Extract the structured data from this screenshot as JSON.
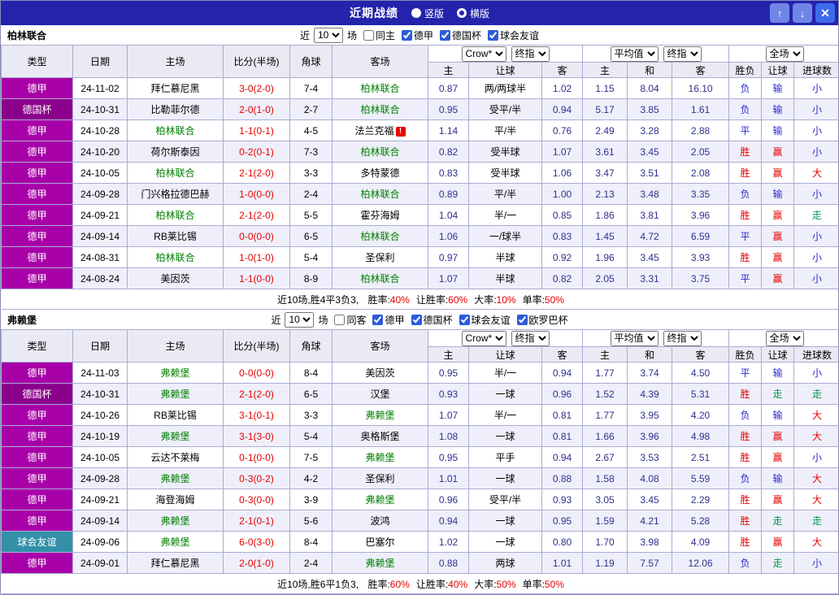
{
  "titlebar": {
    "title": "近期战绩",
    "vertical_label": "竖版",
    "horizontal_label": "横版",
    "selected_layout": "横版",
    "up_label": "↑",
    "down_label": "↓",
    "close_label": "✕"
  },
  "filter_labels": {
    "recent": "近",
    "games": "场"
  },
  "headers": {
    "type": "类型",
    "date": "日期",
    "home": "主场",
    "score": "比分(半场)",
    "corner": "角球",
    "away": "客场",
    "asian_dropdowns": [
      "Crow*",
      "终指"
    ],
    "euro_dropdowns": [
      "平均值",
      "终指"
    ],
    "full_dropdown": "全场",
    "asian_cols": [
      "主",
      "让球",
      "客"
    ],
    "euro_cols": [
      "主",
      "和",
      "客"
    ],
    "result_cols": [
      "胜负",
      "让球",
      "进球数"
    ]
  },
  "colors": {
    "accent": "#2323AC",
    "self_team": "#008000",
    "score": "#E60000",
    "odds": "#30308C",
    "league": {
      "德甲": "#A800A8",
      "德国杯": "#8B008B",
      "球会友谊": "#3390A8"
    },
    "result": {
      "胜": "#E60000",
      "赢": "#E60000",
      "大": "#E60000",
      "平": "#2929CC",
      "负": "#2929CC",
      "输": "#2929CC",
      "小": "#2929CC",
      "走": "#00994D"
    }
  },
  "sections": [
    {
      "team": "柏林联合",
      "filters": {
        "count": "10",
        "venue": "同主",
        "venue_checked": false,
        "leagues": [
          "德甲",
          "德国杯",
          "球会友谊"
        ]
      },
      "rows": [
        {
          "league": "德甲",
          "date": "24-11-02",
          "home": "拜仁慕尼黑",
          "home_self": false,
          "score": "3-0(2-0)",
          "corner": "7-4",
          "away": "柏林联合",
          "away_self": true,
          "away_alert": false,
          "asian": [
            "0.87",
            "两/两球半",
            "1.02"
          ],
          "euro": [
            "1.15",
            "8.04",
            "16.10"
          ],
          "results": [
            "负",
            "输",
            "小"
          ]
        },
        {
          "league": "德国杯",
          "date": "24-10-31",
          "home": "比勒菲尔德",
          "home_self": false,
          "score": "2-0(1-0)",
          "corner": "2-7",
          "away": "柏林联合",
          "away_self": true,
          "away_alert": false,
          "asian": [
            "0.95",
            "受平/半",
            "0.94"
          ],
          "euro": [
            "5.17",
            "3.85",
            "1.61"
          ],
          "results": [
            "负",
            "输",
            "小"
          ]
        },
        {
          "league": "德甲",
          "date": "24-10-28",
          "home": "柏林联合",
          "home_self": true,
          "score": "1-1(0-1)",
          "corner": "4-5",
          "away": "法兰克福",
          "away_self": false,
          "away_alert": true,
          "asian": [
            "1.14",
            "平/半",
            "0.76"
          ],
          "euro": [
            "2.49",
            "3.28",
            "2.88"
          ],
          "results": [
            "平",
            "输",
            "小"
          ]
        },
        {
          "league": "德甲",
          "date": "24-10-20",
          "home": "荷尔斯泰因",
          "home_self": false,
          "score": "0-2(0-1)",
          "corner": "7-3",
          "away": "柏林联合",
          "away_self": true,
          "away_alert": false,
          "asian": [
            "0.82",
            "受半球",
            "1.07"
          ],
          "euro": [
            "3.61",
            "3.45",
            "2.05"
          ],
          "results": [
            "胜",
            "赢",
            "小"
          ]
        },
        {
          "league": "德甲",
          "date": "24-10-05",
          "home": "柏林联合",
          "home_self": true,
          "score": "2-1(2-0)",
          "corner": "3-3",
          "away": "多特蒙德",
          "away_self": false,
          "away_alert": false,
          "asian": [
            "0.83",
            "受半球",
            "1.06"
          ],
          "euro": [
            "3.47",
            "3.51",
            "2.08"
          ],
          "results": [
            "胜",
            "赢",
            "大"
          ]
        },
        {
          "league": "德甲",
          "date": "24-09-28",
          "home": "门兴格拉德巴赫",
          "home_self": false,
          "score": "1-0(0-0)",
          "corner": "2-4",
          "away": "柏林联合",
          "away_self": true,
          "away_alert": false,
          "asian": [
            "0.89",
            "平/半",
            "1.00"
          ],
          "euro": [
            "2.13",
            "3.48",
            "3.35"
          ],
          "results": [
            "负",
            "输",
            "小"
          ]
        },
        {
          "league": "德甲",
          "date": "24-09-21",
          "home": "柏林联合",
          "home_self": true,
          "score": "2-1(2-0)",
          "corner": "5-5",
          "away": "霍芬海姆",
          "away_self": false,
          "away_alert": false,
          "asian": [
            "1.04",
            "半/一",
            "0.85"
          ],
          "euro": [
            "1.86",
            "3.81",
            "3.96"
          ],
          "results": [
            "胜",
            "赢",
            "走"
          ]
        },
        {
          "league": "德甲",
          "date": "24-09-14",
          "home": "RB莱比锡",
          "home_self": false,
          "score": "0-0(0-0)",
          "corner": "6-5",
          "away": "柏林联合",
          "away_self": true,
          "away_alert": false,
          "asian": [
            "1.06",
            "一/球半",
            "0.83"
          ],
          "euro": [
            "1.45",
            "4.72",
            "6.59"
          ],
          "results": [
            "平",
            "赢",
            "小"
          ]
        },
        {
          "league": "德甲",
          "date": "24-08-31",
          "home": "柏林联合",
          "home_self": true,
          "score": "1-0(1-0)",
          "corner": "5-4",
          "away": "圣保利",
          "away_self": false,
          "away_alert": false,
          "asian": [
            "0.97",
            "半球",
            "0.92"
          ],
          "euro": [
            "1.96",
            "3.45",
            "3.93"
          ],
          "results": [
            "胜",
            "赢",
            "小"
          ]
        },
        {
          "league": "德甲",
          "date": "24-08-24",
          "home": "美因茨",
          "home_self": false,
          "score": "1-1(0-0)",
          "corner": "8-9",
          "away": "柏林联合",
          "away_self": true,
          "away_alert": false,
          "asian": [
            "1.07",
            "半球",
            "0.82"
          ],
          "euro": [
            "2.05",
            "3.31",
            "3.75"
          ],
          "results": [
            "平",
            "赢",
            "小"
          ]
        }
      ],
      "summary": {
        "prefix": "近10场,胜4平3负3, ",
        "stats": [
          {
            "label": "胜率:",
            "value": "40%"
          },
          {
            "label": "让胜率:",
            "value": "60%"
          },
          {
            "label": "大率:",
            "value": "10%"
          },
          {
            "label": "单率:",
            "value": "50%"
          }
        ]
      }
    },
    {
      "team": "弗赖堡",
      "filters": {
        "count": "10",
        "venue": "同客",
        "venue_checked": false,
        "leagues": [
          "德甲",
          "德国杯",
          "球会友谊",
          "欧罗巴杯"
        ]
      },
      "rows": [
        {
          "league": "德甲",
          "date": "24-11-03",
          "home": "弗赖堡",
          "home_self": true,
          "score": "0-0(0-0)",
          "corner": "8-4",
          "away": "美因茨",
          "away_self": false,
          "away_alert": false,
          "asian": [
            "0.95",
            "半/一",
            "0.94"
          ],
          "euro": [
            "1.77",
            "3.74",
            "4.50"
          ],
          "results": [
            "平",
            "输",
            "小"
          ]
        },
        {
          "league": "德国杯",
          "date": "24-10-31",
          "home": "弗赖堡",
          "home_self": true,
          "score": "2-1(2-0)",
          "corner": "6-5",
          "away": "汉堡",
          "away_self": false,
          "away_alert": false,
          "asian": [
            "0.93",
            "一球",
            "0.96"
          ],
          "euro": [
            "1.52",
            "4.39",
            "5.31"
          ],
          "results": [
            "胜",
            "走",
            "走"
          ]
        },
        {
          "league": "德甲",
          "date": "24-10-26",
          "home": "RB莱比锡",
          "home_self": false,
          "score": "3-1(0-1)",
          "corner": "3-3",
          "away": "弗赖堡",
          "away_self": true,
          "away_alert": false,
          "asian": [
            "1.07",
            "半/一",
            "0.81"
          ],
          "euro": [
            "1.77",
            "3.95",
            "4.20"
          ],
          "results": [
            "负",
            "输",
            "大"
          ]
        },
        {
          "league": "德甲",
          "date": "24-10-19",
          "home": "弗赖堡",
          "home_self": true,
          "score": "3-1(3-0)",
          "corner": "5-4",
          "away": "奥格斯堡",
          "away_self": false,
          "away_alert": false,
          "asian": [
            "1.08",
            "一球",
            "0.81"
          ],
          "euro": [
            "1.66",
            "3.96",
            "4.98"
          ],
          "results": [
            "胜",
            "赢",
            "大"
          ]
        },
        {
          "league": "德甲",
          "date": "24-10-05",
          "home": "云达不莱梅",
          "home_self": false,
          "score": "0-1(0-0)",
          "corner": "7-5",
          "away": "弗赖堡",
          "away_self": true,
          "away_alert": false,
          "asian": [
            "0.95",
            "平手",
            "0.94"
          ],
          "euro": [
            "2.67",
            "3.53",
            "2.51"
          ],
          "results": [
            "胜",
            "赢",
            "小"
          ]
        },
        {
          "league": "德甲",
          "date": "24-09-28",
          "home": "弗赖堡",
          "home_self": true,
          "score": "0-3(0-2)",
          "corner": "4-2",
          "away": "圣保利",
          "away_self": false,
          "away_alert": false,
          "asian": [
            "1.01",
            "一球",
            "0.88"
          ],
          "euro": [
            "1.58",
            "4.08",
            "5.59"
          ],
          "results": [
            "负",
            "输",
            "大"
          ]
        },
        {
          "league": "德甲",
          "date": "24-09-21",
          "home": "海登海姆",
          "home_self": false,
          "score": "0-3(0-0)",
          "corner": "3-9",
          "away": "弗赖堡",
          "away_self": true,
          "away_alert": false,
          "asian": [
            "0.96",
            "受平/半",
            "0.93"
          ],
          "euro": [
            "3.05",
            "3.45",
            "2.29"
          ],
          "results": [
            "胜",
            "赢",
            "大"
          ]
        },
        {
          "league": "德甲",
          "date": "24-09-14",
          "home": "弗赖堡",
          "home_self": true,
          "score": "2-1(0-1)",
          "corner": "5-6",
          "away": "波鸿",
          "away_self": false,
          "away_alert": false,
          "asian": [
            "0.94",
            "一球",
            "0.95"
          ],
          "euro": [
            "1.59",
            "4.21",
            "5.28"
          ],
          "results": [
            "胜",
            "走",
            "走"
          ]
        },
        {
          "league": "球会友谊",
          "date": "24-09-06",
          "home": "弗赖堡",
          "home_self": true,
          "score": "6-0(3-0)",
          "corner": "8-4",
          "away": "巴塞尔",
          "away_self": false,
          "away_alert": false,
          "asian": [
            "1.02",
            "一球",
            "0.80"
          ],
          "euro": [
            "1.70",
            "3.98",
            "4.09"
          ],
          "results": [
            "胜",
            "赢",
            "大"
          ]
        },
        {
          "league": "德甲",
          "date": "24-09-01",
          "home": "拜仁慕尼黑",
          "home_self": false,
          "score": "2-0(1-0)",
          "corner": "2-4",
          "away": "弗赖堡",
          "away_self": true,
          "away_alert": false,
          "asian": [
            "0.88",
            "两球",
            "1.01"
          ],
          "euro": [
            "1.19",
            "7.57",
            "12.06"
          ],
          "results": [
            "负",
            "走",
            "小"
          ]
        }
      ],
      "summary": {
        "prefix": "近10场,胜6平1负3, ",
        "stats": [
          {
            "label": "胜率:",
            "value": "60%"
          },
          {
            "label": "让胜率:",
            "value": "40%"
          },
          {
            "label": "大率:",
            "value": "50%"
          },
          {
            "label": "单率:",
            "value": "50%"
          }
        ]
      }
    }
  ]
}
